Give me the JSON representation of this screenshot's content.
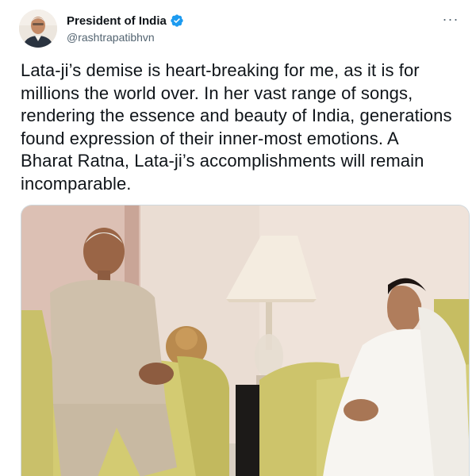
{
  "author": {
    "display_name": "President of India",
    "handle": "@rashtrapatibhvn",
    "verified": true,
    "avatar_icon": "profile-photo",
    "verified_icon": "verified-badge-icon"
  },
  "menu": {
    "icon": "more-options-icon",
    "glyph": "···"
  },
  "tweet": {
    "text": "Lata-ji’s demise is heart-breaking for me, as it is for\nmillions the world over. In her vast range of songs,\nrendering the essence and beauty of India, generations\nfound expression of their inner-most emotions. A\nBharat Ratna, Lata-ji’s accomplishments will remain\nincomparable."
  },
  "media": {
    "type": "photo",
    "icon": "attached-photo"
  },
  "colors": {
    "text": "#0f1419",
    "secondary": "#536471",
    "verified": "#1d9bf0",
    "border": "#cfd9de"
  }
}
